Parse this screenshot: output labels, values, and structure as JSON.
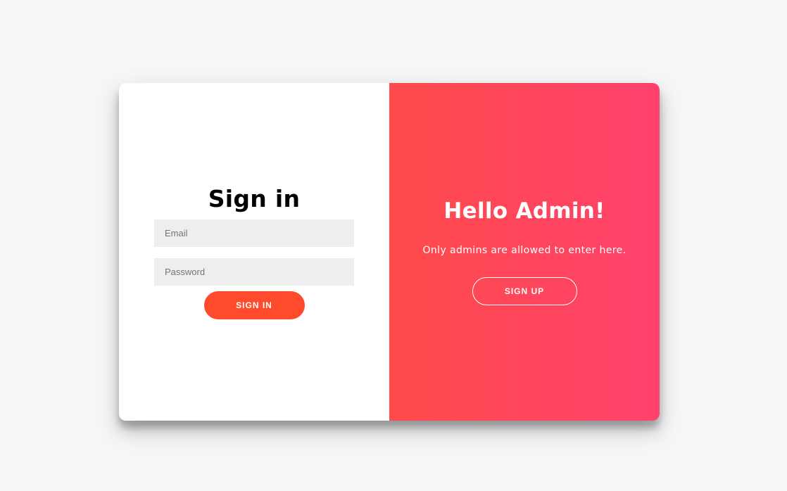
{
  "signin": {
    "title": "Sign in",
    "email_placeholder": "Email",
    "password_placeholder": "Password",
    "button_label": "SIGN IN"
  },
  "overlay": {
    "title": "Hello Admin!",
    "text": "Only admins are allowed to enter here.",
    "button_label": "SIGN UP"
  },
  "colors": {
    "page_background": "#f5f6f8",
    "accent": "#ff4b2b",
    "gradient_start": "#ff4b4b",
    "gradient_end": "#ff416c",
    "input_background": "#eeeeee"
  }
}
